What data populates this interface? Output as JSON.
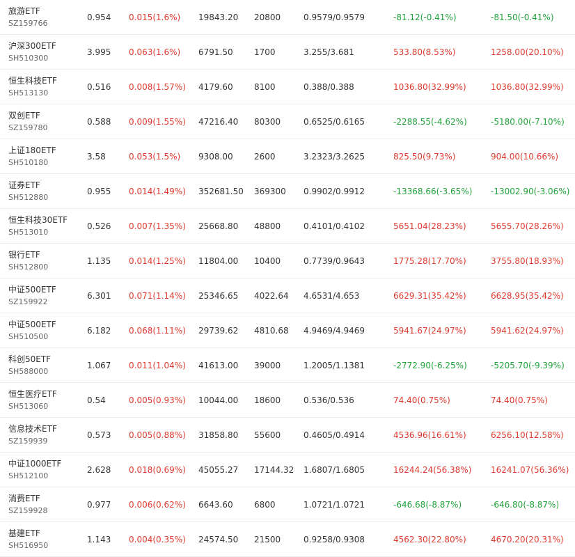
{
  "colors": {
    "up": "#e03a2f",
    "down": "#21a33b"
  },
  "rows": [
    {
      "name": "旅游ETF",
      "code": "SZ159766",
      "price": "0.954",
      "change": "0.015(1.6%)",
      "amount": "19843.20",
      "volume": "20800",
      "nav": "0.9579/0.9579",
      "profit1": "-81.12(-0.41%)",
      "profit1_dir": "down",
      "profit2": "-81.50(-0.41%)",
      "profit2_dir": "down"
    },
    {
      "name": "沪深300ETF",
      "code": "SH510300",
      "price": "3.995",
      "change": "0.063(1.6%)",
      "amount": "6791.50",
      "volume": "1700",
      "nav": "3.255/3.681",
      "profit1": "533.80(8.53%)",
      "profit1_dir": "up",
      "profit2": "1258.00(20.10%)",
      "profit2_dir": "up"
    },
    {
      "name": "恒生科技ETF",
      "code": "SH513130",
      "price": "0.516",
      "change": "0.008(1.57%)",
      "amount": "4179.60",
      "volume": "8100",
      "nav": "0.388/0.388",
      "profit1": "1036.80(32.99%)",
      "profit1_dir": "up",
      "profit2": "1036.80(32.99%)",
      "profit2_dir": "up"
    },
    {
      "name": "双创ETF",
      "code": "SZ159780",
      "price": "0.588",
      "change": "0.009(1.55%)",
      "amount": "47216.40",
      "volume": "80300",
      "nav": "0.6525/0.6165",
      "profit1": "-2288.55(-4.62%)",
      "profit1_dir": "down",
      "profit2": "-5180.00(-7.10%)",
      "profit2_dir": "down"
    },
    {
      "name": "上证180ETF",
      "code": "SH510180",
      "price": "3.58",
      "change": "0.053(1.5%)",
      "amount": "9308.00",
      "volume": "2600",
      "nav": "3.2323/3.2625",
      "profit1": "825.50(9.73%)",
      "profit1_dir": "up",
      "profit2": "904.00(10.66%)",
      "profit2_dir": "up"
    },
    {
      "name": "证券ETF",
      "code": "SH512880",
      "price": "0.955",
      "change": "0.014(1.49%)",
      "amount": "352681.50",
      "volume": "369300",
      "nav": "0.9902/0.9912",
      "profit1": "-13368.66(-3.65%)",
      "profit1_dir": "down",
      "profit2": "-13002.90(-3.06%)",
      "profit2_dir": "down"
    },
    {
      "name": "恒生科技30ETF",
      "code": "SH513010",
      "price": "0.526",
      "change": "0.007(1.35%)",
      "amount": "25668.80",
      "volume": "48800",
      "nav": "0.4101/0.4102",
      "profit1": "5651.04(28.23%)",
      "profit1_dir": "up",
      "profit2": "5655.70(28.26%)",
      "profit2_dir": "up"
    },
    {
      "name": "银行ETF",
      "code": "SH512800",
      "price": "1.135",
      "change": "0.014(1.25%)",
      "amount": "11804.00",
      "volume": "10400",
      "nav": "0.7739/0.9643",
      "profit1": "1775.28(17.70%)",
      "profit1_dir": "up",
      "profit2": "3755.80(18.93%)",
      "profit2_dir": "up"
    },
    {
      "name": "中证500ETF",
      "code": "SZ159922",
      "price": "6.301",
      "change": "0.071(1.14%)",
      "amount": "25346.65",
      "volume": "4022.64",
      "nav": "4.6531/4.653",
      "profit1": "6629.31(35.42%)",
      "profit1_dir": "up",
      "profit2": "6628.95(35.42%)",
      "profit2_dir": "up"
    },
    {
      "name": "中证500ETF",
      "code": "SH510500",
      "price": "6.182",
      "change": "0.068(1.11%)",
      "amount": "29739.62",
      "volume": "4810.68",
      "nav": "4.9469/4.9469",
      "profit1": "5941.67(24.97%)",
      "profit1_dir": "up",
      "profit2": "5941.62(24.97%)",
      "profit2_dir": "up"
    },
    {
      "name": "科创50ETF",
      "code": "SH588000",
      "price": "1.067",
      "change": "0.011(1.04%)",
      "amount": "41613.00",
      "volume": "39000",
      "nav": "1.2005/1.1381",
      "profit1": "-2772.90(-6.25%)",
      "profit1_dir": "down",
      "profit2": "-5205.70(-9.39%)",
      "profit2_dir": "down"
    },
    {
      "name": "恒生医疗ETF",
      "code": "SH513060",
      "price": "0.54",
      "change": "0.005(0.93%)",
      "amount": "10044.00",
      "volume": "18600",
      "nav": "0.536/0.536",
      "profit1": "74.40(0.75%)",
      "profit1_dir": "up",
      "profit2": "74.40(0.75%)",
      "profit2_dir": "up"
    },
    {
      "name": "信息技术ETF",
      "code": "SZ159939",
      "price": "0.573",
      "change": "0.005(0.88%)",
      "amount": "31858.80",
      "volume": "55600",
      "nav": "0.4605/0.4914",
      "profit1": "4536.96(16.61%)",
      "profit1_dir": "up",
      "profit2": "6256.10(12.58%)",
      "profit2_dir": "up"
    },
    {
      "name": "中证1000ETF",
      "code": "SH512100",
      "price": "2.628",
      "change": "0.018(0.69%)",
      "amount": "45055.27",
      "volume": "17144.32",
      "nav": "1.6807/1.6805",
      "profit1": "16244.24(56.38%)",
      "profit1_dir": "up",
      "profit2": "16241.07(56.36%)",
      "profit2_dir": "up"
    },
    {
      "name": "消费ETF",
      "code": "SZ159928",
      "price": "0.977",
      "change": "0.006(0.62%)",
      "amount": "6643.60",
      "volume": "6800",
      "nav": "1.0721/1.0721",
      "profit1": "-646.68(-8.87%)",
      "profit1_dir": "down",
      "profit2": "-646.80(-8.87%)",
      "profit2_dir": "down"
    },
    {
      "name": "基建ETF",
      "code": "SH516950",
      "price": "1.143",
      "change": "0.004(0.35%)",
      "amount": "24574.50",
      "volume": "21500",
      "nav": "0.9258/0.9308",
      "profit1": "4562.30(22.80%)",
      "profit1_dir": "up",
      "profit2": "4670.20(20.31%)",
      "profit2_dir": "up"
    }
  ]
}
